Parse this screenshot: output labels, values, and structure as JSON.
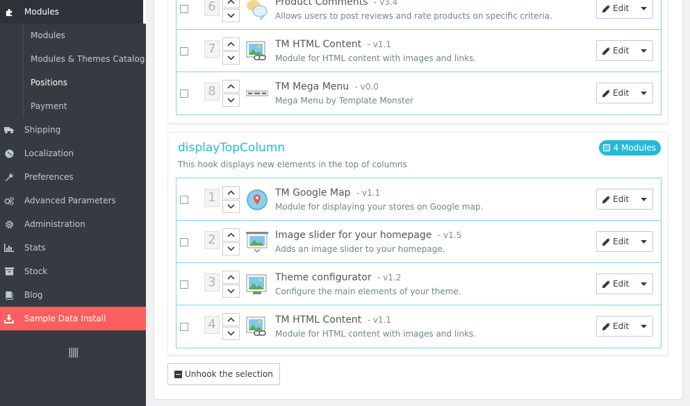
{
  "sidebar": {
    "items": [
      {
        "label": "Modules",
        "icon": "puzzle-icon"
      },
      {
        "label": "Shipping",
        "icon": "truck-icon"
      },
      {
        "label": "Localization",
        "icon": "globe-icon"
      },
      {
        "label": "Preferences",
        "icon": "wrench-icon"
      },
      {
        "label": "Advanced Parameters",
        "icon": "cogs-icon"
      },
      {
        "label": "Administration",
        "icon": "gear-icon"
      },
      {
        "label": "Stats",
        "icon": "bar-chart-icon"
      },
      {
        "label": "Stock",
        "icon": "archive-icon"
      },
      {
        "label": "Blog",
        "icon": "book-icon"
      },
      {
        "label": "Sample Data Install",
        "icon": "download-icon"
      }
    ],
    "subitems": [
      {
        "label": "Modules"
      },
      {
        "label": "Modules & Themes Catalog"
      },
      {
        "label": "Positions"
      },
      {
        "label": "Payment"
      }
    ],
    "collapse_icon": "|||||",
    "accent_color": "#fe5e5d"
  },
  "hook1": {
    "modules": [
      {
        "position": "6",
        "name": "Product Comments",
        "version": "- v3.4",
        "description": "Allows users to post reviews and rate products on specific criteria.",
        "icon": "comments-icon",
        "edit_label": "Edit"
      },
      {
        "position": "7",
        "name": "TM HTML Content",
        "version": "- v1.1",
        "description": "Module for HTML content with images and links.",
        "icon": "html-content-icon",
        "edit_label": "Edit"
      },
      {
        "position": "8",
        "name": "TM Mega Menu",
        "version": "- v0.0",
        "description": "Mega Menu by Template Monster",
        "icon": "mega-menu-icon",
        "edit_label": "Edit"
      }
    ]
  },
  "hook2": {
    "title": "displayTopColumn",
    "description": "This hook displays new elements in the top of columns",
    "badge": "4 Modules",
    "modules": [
      {
        "position": "1",
        "name": "TM Google Map",
        "version": "- v1.1",
        "description": "Module for displaying your stores on Google map.",
        "icon": "map-pin-icon",
        "edit_label": "Edit"
      },
      {
        "position": "2",
        "name": "Image slider for your homepage",
        "version": "- v1.5",
        "description": "Adds an image slider to your homepage.",
        "icon": "image-slider-icon",
        "edit_label": "Edit"
      },
      {
        "position": "3",
        "name": "Theme configurator",
        "version": "- v1.2",
        "description": "Configure the main elements of your theme.",
        "icon": "theme-config-icon",
        "edit_label": "Edit"
      },
      {
        "position": "4",
        "name": "TM HTML Content",
        "version": "- v1.1",
        "description": "Module for HTML content with images and links.",
        "icon": "html-content-icon",
        "edit_label": "Edit"
      }
    ]
  },
  "unhook_label": "Unhook the selection",
  "colors": {
    "brand": "#25b9d7",
    "sidebar_bg": "#363a41",
    "row_border": "#7cd5e7"
  }
}
